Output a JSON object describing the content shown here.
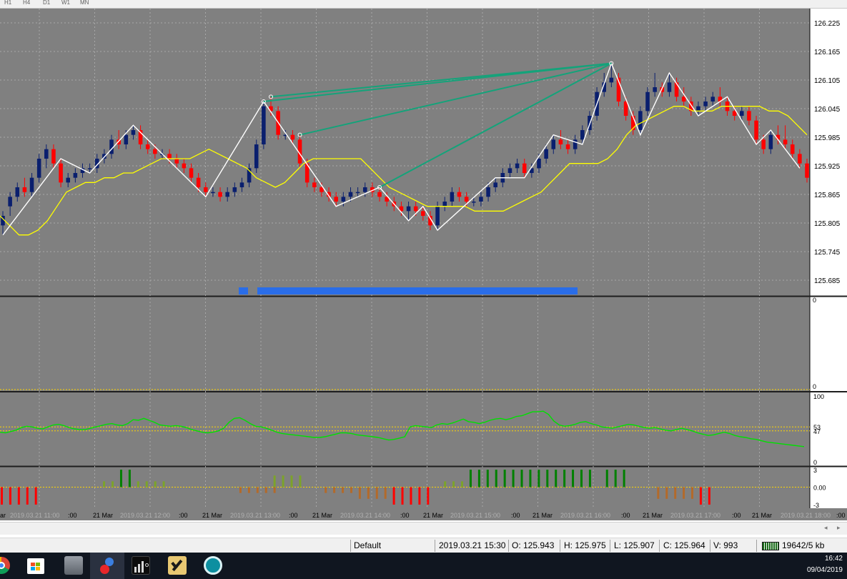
{
  "toolbar": {
    "timeframes": [
      "H1",
      "H4",
      "D1",
      "W1",
      "MN"
    ]
  },
  "chart_data": [
    {
      "type": "candlestick",
      "panel": "main",
      "y_ticks": [
        "126.225",
        "126.165",
        "126.105",
        "126.045",
        "125.985",
        "125.925",
        "125.865",
        "125.805",
        "125.745",
        "125.685"
      ],
      "ylim": [
        125.655,
        126.255
      ],
      "candles": [
        [
          125.8,
          125.83,
          125.78,
          125.82
        ],
        [
          125.84,
          125.87,
          125.82,
          125.86
        ],
        [
          125.86,
          125.89,
          125.85,
          125.88
        ],
        [
          125.88,
          125.9,
          125.86,
          125.87
        ],
        [
          125.87,
          125.91,
          125.86,
          125.9
        ],
        [
          125.9,
          125.95,
          125.89,
          125.94
        ],
        [
          125.94,
          125.97,
          125.92,
          125.96
        ],
        [
          125.96,
          125.97,
          125.92,
          125.93
        ],
        [
          125.93,
          125.94,
          125.88,
          125.89
        ],
        [
          125.89,
          125.91,
          125.88,
          125.9
        ],
        [
          125.9,
          125.92,
          125.89,
          125.91
        ],
        [
          125.91,
          125.93,
          125.9,
          125.92
        ],
        [
          125.92,
          125.93,
          125.91,
          125.92
        ],
        [
          125.92,
          125.95,
          125.91,
          125.94
        ],
        [
          125.94,
          125.96,
          125.93,
          125.95
        ],
        [
          125.95,
          125.99,
          125.94,
          125.98
        ],
        [
          125.98,
          126.0,
          125.96,
          125.97
        ],
        [
          125.97,
          126.0,
          125.96,
          125.99
        ],
        [
          125.99,
          126.01,
          125.98,
          126.0
        ],
        [
          126.0,
          126.01,
          125.96,
          125.97
        ],
        [
          125.97,
          125.98,
          125.95,
          125.96
        ],
        [
          125.96,
          125.97,
          125.94,
          125.95
        ],
        [
          125.95,
          125.96,
          125.94,
          125.95
        ],
        [
          125.95,
          125.96,
          125.93,
          125.94
        ],
        [
          125.94,
          125.95,
          125.92,
          125.93
        ],
        [
          125.93,
          125.94,
          125.91,
          125.92
        ],
        [
          125.92,
          125.93,
          125.89,
          125.9
        ],
        [
          125.9,
          125.91,
          125.87,
          125.88
        ],
        [
          125.88,
          125.89,
          125.86,
          125.87
        ],
        [
          125.87,
          125.88,
          125.86,
          125.87
        ],
        [
          125.87,
          125.88,
          125.85,
          125.86
        ],
        [
          125.86,
          125.88,
          125.85,
          125.87
        ],
        [
          125.87,
          125.89,
          125.86,
          125.88
        ],
        [
          125.88,
          125.9,
          125.87,
          125.89
        ],
        [
          125.89,
          125.93,
          125.88,
          125.92
        ],
        [
          125.92,
          125.98,
          125.91,
          125.97
        ],
        [
          125.97,
          126.06,
          125.96,
          126.05
        ],
        [
          126.05,
          126.07,
          126.03,
          126.04
        ],
        [
          126.04,
          126.05,
          125.98,
          125.99
        ],
        [
          125.99,
          126.0,
          125.98,
          125.99
        ],
        [
          125.99,
          126.0,
          125.97,
          125.98
        ],
        [
          125.98,
          125.99,
          125.92,
          125.93
        ],
        [
          125.93,
          125.94,
          125.88,
          125.89
        ],
        [
          125.89,
          125.9,
          125.87,
          125.88
        ],
        [
          125.88,
          125.89,
          125.86,
          125.87
        ],
        [
          125.87,
          125.88,
          125.85,
          125.86
        ],
        [
          125.86,
          125.87,
          125.84,
          125.85
        ],
        [
          125.85,
          125.87,
          125.84,
          125.86
        ],
        [
          125.86,
          125.88,
          125.85,
          125.87
        ],
        [
          125.87,
          125.88,
          125.86,
          125.87
        ],
        [
          125.87,
          125.89,
          125.86,
          125.88
        ],
        [
          125.88,
          125.89,
          125.86,
          125.87
        ],
        [
          125.87,
          125.88,
          125.85,
          125.86
        ],
        [
          125.86,
          125.87,
          125.84,
          125.85
        ],
        [
          125.85,
          125.86,
          125.83,
          125.84
        ],
        [
          125.84,
          125.85,
          125.82,
          125.83
        ],
        [
          125.83,
          125.85,
          125.81,
          125.84
        ],
        [
          125.84,
          125.85,
          125.82,
          125.83
        ],
        [
          125.83,
          125.84,
          125.81,
          125.82
        ],
        [
          125.82,
          125.83,
          125.79,
          125.8
        ],
        [
          125.8,
          125.85,
          125.79,
          125.84
        ],
        [
          125.84,
          125.86,
          125.83,
          125.85
        ],
        [
          125.85,
          125.88,
          125.84,
          125.87
        ],
        [
          125.87,
          125.88,
          125.85,
          125.86
        ],
        [
          125.86,
          125.87,
          125.84,
          125.85
        ],
        [
          125.85,
          125.86,
          125.84,
          125.85
        ],
        [
          125.85,
          125.87,
          125.84,
          125.86
        ],
        [
          125.86,
          125.89,
          125.85,
          125.88
        ],
        [
          125.88,
          125.9,
          125.87,
          125.89
        ],
        [
          125.89,
          125.92,
          125.88,
          125.91
        ],
        [
          125.91,
          125.93,
          125.9,
          125.92
        ],
        [
          125.92,
          125.94,
          125.91,
          125.93
        ],
        [
          125.93,
          125.94,
          125.9,
          125.91
        ],
        [
          125.91,
          125.93,
          125.9,
          125.92
        ],
        [
          125.92,
          125.95,
          125.91,
          125.94
        ],
        [
          125.94,
          125.97,
          125.93,
          125.96
        ],
        [
          125.96,
          125.99,
          125.95,
          125.98
        ],
        [
          125.98,
          126.0,
          125.96,
          125.97
        ],
        [
          125.97,
          125.98,
          125.95,
          125.96
        ],
        [
          125.96,
          125.99,
          125.95,
          125.98
        ],
        [
          125.98,
          126.01,
          125.97,
          126.0
        ],
        [
          126.0,
          126.04,
          125.99,
          126.03
        ],
        [
          126.03,
          126.09,
          126.02,
          126.08
        ],
        [
          126.08,
          126.12,
          126.07,
          126.1
        ],
        [
          126.1,
          126.14,
          126.09,
          126.11
        ],
        [
          126.11,
          126.12,
          126.05,
          126.06
        ],
        [
          126.06,
          126.07,
          126.02,
          126.03
        ],
        [
          126.03,
          126.04,
          125.99,
          126.0
        ],
        [
          126.0,
          126.05,
          125.99,
          126.04
        ],
        [
          126.04,
          126.09,
          126.03,
          126.08
        ],
        [
          126.08,
          126.12,
          126.07,
          126.09
        ],
        [
          126.09,
          126.1,
          126.07,
          126.08
        ],
        [
          126.08,
          126.12,
          126.07,
          126.1
        ],
        [
          126.1,
          126.11,
          126.06,
          126.07
        ],
        [
          126.07,
          126.09,
          126.05,
          126.06
        ],
        [
          126.06,
          126.07,
          126.03,
          126.04
        ],
        [
          126.04,
          126.06,
          126.03,
          126.05
        ],
        [
          126.05,
          126.07,
          126.04,
          126.06
        ],
        [
          126.06,
          126.08,
          126.05,
          126.07
        ],
        [
          126.07,
          126.09,
          126.05,
          126.06
        ],
        [
          126.06,
          126.07,
          126.03,
          126.04
        ],
        [
          126.04,
          126.05,
          126.02,
          126.03
        ],
        [
          126.03,
          126.05,
          126.02,
          126.04
        ],
        [
          126.04,
          126.05,
          126.01,
          126.02
        ],
        [
          126.02,
          126.03,
          125.97,
          125.98
        ],
        [
          125.98,
          125.99,
          125.95,
          125.96
        ],
        [
          125.96,
          126.0,
          125.95,
          125.99
        ],
        [
          125.99,
          126.01,
          125.97,
          125.98
        ],
        [
          125.98,
          126.01,
          125.96,
          125.97
        ],
        [
          125.97,
          125.98,
          125.94,
          125.95
        ],
        [
          125.95,
          125.96,
          125.92,
          125.93
        ],
        [
          125.93,
          125.94,
          125.89,
          125.9
        ]
      ],
      "moving_average": [
        125.82,
        125.8,
        125.78,
        125.78,
        125.79,
        125.81,
        125.84,
        125.87,
        125.88,
        125.89,
        125.89,
        125.9,
        125.9,
        125.91,
        125.91,
        125.92,
        125.93,
        125.94,
        125.94,
        125.94,
        125.94,
        125.95,
        125.96,
        125.95,
        125.94,
        125.93,
        125.92,
        125.9,
        125.89,
        125.88,
        125.89,
        125.91,
        125.93,
        125.94,
        125.94,
        125.94,
        125.94,
        125.94,
        125.94,
        125.92,
        125.9,
        125.88,
        125.87,
        125.86,
        125.85,
        125.84,
        125.84,
        125.84,
        125.84,
        125.84,
        125.83,
        125.83,
        125.83,
        125.83,
        125.84,
        125.85,
        125.86,
        125.87,
        125.89,
        125.91,
        125.93,
        125.93,
        125.93,
        125.93,
        125.94,
        125.96,
        125.99,
        126.01,
        126.02,
        126.03,
        126.04,
        126.05,
        126.05,
        126.04,
        126.04,
        126.04,
        126.05,
        126.05,
        126.05,
        126.05,
        126.05,
        126.04,
        126.04,
        126.03,
        126.01,
        125.99
      ],
      "blue_bar_start_x": 334,
      "blue_bar_end_x": 808
    },
    {
      "type": "line",
      "panel": "oscillator",
      "y_ticks": [
        "100",
        "53",
        "47",
        "0"
      ],
      "levels": [
        53,
        47
      ],
      "values": [
        45,
        44,
        46,
        48,
        52,
        54,
        53,
        51,
        50,
        53,
        56,
        57,
        55,
        52,
        50,
        49,
        49,
        51,
        53,
        55,
        57,
        58,
        56,
        55,
        58,
        64,
        63,
        66,
        63,
        60,
        56,
        55,
        54,
        55,
        54,
        52,
        49,
        47,
        45,
        44,
        45,
        47,
        51,
        60,
        66,
        67,
        63,
        58,
        54,
        53,
        51,
        48,
        45,
        43,
        42,
        41,
        40,
        39,
        38,
        37,
        37,
        38,
        40,
        42,
        44,
        44,
        43,
        41,
        40,
        39,
        38,
        37,
        35,
        33,
        34,
        36,
        38,
        53,
        55,
        54,
        53,
        52,
        56,
        58,
        57,
        59,
        62,
        65,
        61,
        60,
        58,
        60,
        63,
        65,
        66,
        64,
        66,
        69,
        70,
        73,
        76,
        76,
        77,
        72,
        62,
        56,
        54,
        55,
        57,
        60,
        61,
        58,
        56,
        53,
        52,
        51,
        53,
        55,
        57,
        56,
        54,
        52,
        51,
        52,
        50,
        48,
        47,
        49,
        51,
        49,
        47,
        44,
        42,
        40,
        41,
        43,
        45,
        43,
        40,
        38,
        37,
        35,
        34,
        32,
        30,
        29,
        28,
        27,
        26,
        25,
        24,
        23
      ]
    },
    {
      "type": "histogram",
      "panel": "histogram",
      "y_ticks": [
        "3",
        "0.00",
        "-3"
      ],
      "ylim": [
        -3.5,
        3.5
      ]
    }
  ],
  "time_axis": {
    "ticks": [
      {
        "label": "ar",
        "x": 0
      },
      {
        "label": ":00",
        "x": 95
      },
      {
        "label": "21 Mar",
        "x": 130
      },
      {
        "label": ":00",
        "x": 250
      },
      {
        "label": "21 Mar",
        "x": 283
      },
      {
        "label": ":00",
        "x": 404
      },
      {
        "label": "21 Mar",
        "x": 437
      },
      {
        "label": ":00",
        "x": 560
      },
      {
        "label": "21 Mar",
        "x": 592
      },
      {
        "label": ":00",
        "x": 715
      },
      {
        "label": "21 Mar",
        "x": 745
      },
      {
        "label": ":00",
        "x": 869
      },
      {
        "label": "21 Mar",
        "x": 899
      },
      {
        "label": ":00",
        "x": 1024
      },
      {
        "label": "21 Mar",
        "x": 1052
      },
      {
        "label": ":00",
        "x": 1170
      }
    ],
    "period_separators": [
      "2019.03.21 11:00",
      "2019.03.21 12:00",
      "2019.03.21 13:00",
      "2019.03.21 14:00",
      "2019.03.21 15:00",
      "2019.03.21 16:00",
      "2019.03.21 17:00",
      "2019.03.21 18:00"
    ]
  },
  "status": {
    "profile": "Default",
    "datetime": "2019.03.21 15:30",
    "open": "O: 125.943",
    "high": "H: 125.975",
    "low": "L: 125.907",
    "close": "C: 125.964",
    "volume": "V: 993",
    "traffic": "19642/5 kb"
  },
  "taskbar": {
    "time": "16:42",
    "date": "09/04/2019",
    "icons": [
      "chrome-icon",
      "store-icon",
      "file-manager-icon",
      "metatrader-icon",
      "analytics-icon",
      "app-icon",
      "network-icon"
    ]
  },
  "colors": {
    "chart_bg": "#808080",
    "bull": "#0a1f6e",
    "bear": "#ff0000",
    "zigzag": "#ffffff",
    "ma": "#ffff00",
    "trendline": "#14a37a",
    "oscillator": "#00e000",
    "hist_strong_pos": "#008000",
    "hist_weak_pos": "#7ca32a",
    "hist_weak_neg": "#b36a2a",
    "hist_strong_neg": "#ff0000",
    "signal_bar": "#2a6de8"
  }
}
